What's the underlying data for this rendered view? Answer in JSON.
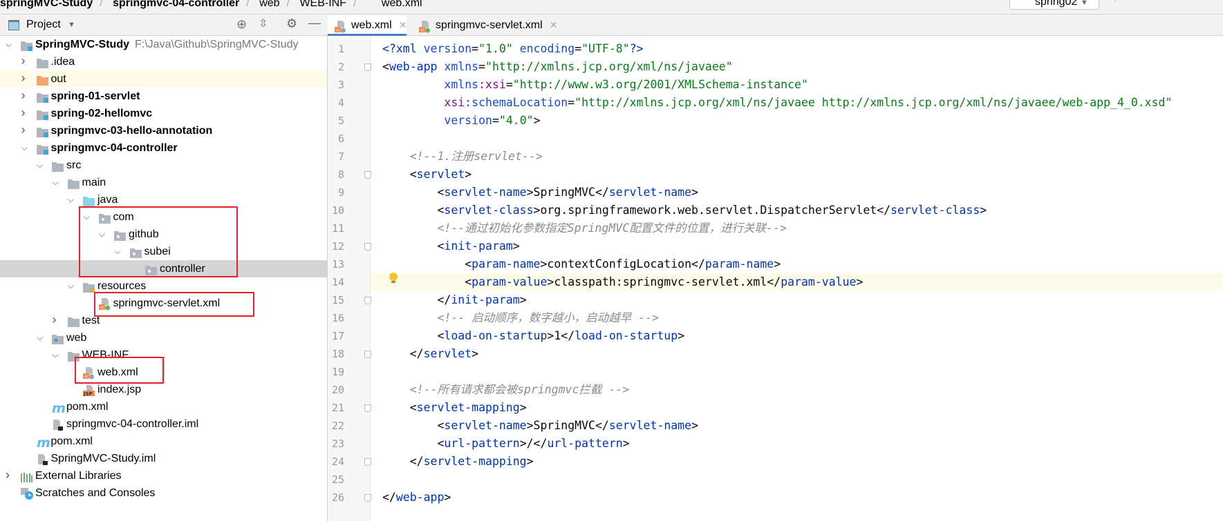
{
  "breadcrumb": [
    "springMVC-Study",
    "springmvc-04-controller",
    "web",
    "WEB-INF",
    "web.xml"
  ],
  "toolbar": {
    "run_config": "spring02"
  },
  "project_panel": {
    "title": "Project",
    "icons": [
      "locate-icon",
      "collapse-all-icon",
      "gear-icon",
      "minimize-icon"
    ]
  },
  "tabs": [
    {
      "label": "web.xml",
      "active": true
    },
    {
      "label": "springmvc-servlet.xml",
      "active": false
    }
  ],
  "tree": [
    {
      "label": "SpringMVC-Study",
      "path": "F:\\Java\\Github\\SpringMVC-Study",
      "level": 0,
      "arrow": "open",
      "icon": "module",
      "bold": true
    },
    {
      "label": ".idea",
      "level": 1,
      "arrow": "closed",
      "icon": "folder"
    },
    {
      "label": "out",
      "level": 1,
      "arrow": "closed",
      "icon": "folder-orange",
      "highlight": true
    },
    {
      "label": "spring-01-servlet",
      "level": 1,
      "arrow": "closed",
      "icon": "module",
      "bold": true
    },
    {
      "label": "spring-02-hellomvc",
      "level": 1,
      "arrow": "closed",
      "icon": "module",
      "bold": true
    },
    {
      "label": "springmvc-03-hello-annotation",
      "level": 1,
      "arrow": "closed",
      "icon": "module",
      "bold": true
    },
    {
      "label": "springmvc-04-controller",
      "level": 1,
      "arrow": "open",
      "icon": "module",
      "bold": true
    },
    {
      "label": "src",
      "level": 2,
      "arrow": "open",
      "icon": "folder"
    },
    {
      "label": "main",
      "level": 3,
      "arrow": "open",
      "icon": "folder"
    },
    {
      "label": "java",
      "level": 4,
      "arrow": "open",
      "icon": "folder-blue"
    },
    {
      "label": "com",
      "level": 5,
      "arrow": "open",
      "icon": "package"
    },
    {
      "label": "github",
      "level": 6,
      "arrow": "open",
      "icon": "package"
    },
    {
      "label": "subei",
      "level": 7,
      "arrow": "open",
      "icon": "package"
    },
    {
      "label": "controller",
      "level": 8,
      "arrow": "none",
      "icon": "package",
      "selected": true
    },
    {
      "label": "resources",
      "level": 4,
      "arrow": "open",
      "icon": "folder-res"
    },
    {
      "label": "springmvc-servlet.xml",
      "level": 5,
      "arrow": "none",
      "icon": "xml-spring"
    },
    {
      "label": "test",
      "level": 3,
      "arrow": "closed",
      "icon": "folder"
    },
    {
      "label": "web",
      "level": 2,
      "arrow": "open",
      "icon": "folder-web"
    },
    {
      "label": "WEB-INF",
      "level": 3,
      "arrow": "open",
      "icon": "folder"
    },
    {
      "label": "web.xml",
      "level": 4,
      "arrow": "none",
      "icon": "xml-web"
    },
    {
      "label": "index.jsp",
      "level": 4,
      "arrow": "none",
      "icon": "jsp"
    },
    {
      "label": "pom.xml",
      "level": 2,
      "arrow": "none",
      "icon": "maven"
    },
    {
      "label": "springmvc-04-controller.iml",
      "level": 2,
      "arrow": "none",
      "icon": "iml"
    },
    {
      "label": "pom.xml",
      "level": 1,
      "arrow": "none",
      "icon": "maven"
    },
    {
      "label": "SpringMVC-Study.iml",
      "level": 1,
      "arrow": "none",
      "icon": "iml"
    },
    {
      "label": "External Libraries",
      "level": 0,
      "arrow": "closed",
      "icon": "libraries"
    },
    {
      "label": "Scratches and Consoles",
      "level": 0,
      "arrow": "none",
      "icon": "scratches"
    }
  ],
  "colors": {
    "tag": "#0033b3",
    "attr": "#174ad4",
    "value": "#067d17",
    "namespace": "#871094",
    "comment": "#8c8c8c",
    "highlight_box": "#e8202a"
  },
  "editor": {
    "current_line": 14,
    "lines": [
      [
        [
          "tag",
          "<?xml "
        ],
        [
          "attr",
          "version"
        ],
        [
          "txt",
          "="
        ],
        [
          "val",
          "\"1.0\" "
        ],
        [
          "attr",
          "encoding"
        ],
        [
          "txt",
          "="
        ],
        [
          "val",
          "\"UTF-8\""
        ],
        [
          "tag",
          "?>"
        ]
      ],
      [
        [
          "txt",
          "<"
        ],
        [
          "tag",
          "web-app "
        ],
        [
          "attr",
          "xmlns"
        ],
        [
          "txt",
          "="
        ],
        [
          "val",
          "\"http://xmlns.jcp.org/xml/ns/javaee\""
        ]
      ],
      [
        [
          "txt",
          "         "
        ],
        [
          "attr",
          "xmlns"
        ],
        [
          "ns",
          ":xsi"
        ],
        [
          "txt",
          "="
        ],
        [
          "val",
          "\"http://www.w3.org/2001/XMLSchema-instance\""
        ]
      ],
      [
        [
          "txt",
          "         "
        ],
        [
          "ns",
          "xsi"
        ],
        [
          "attr",
          ":schemaLocation"
        ],
        [
          "txt",
          "="
        ],
        [
          "val",
          "\"http://xmlns.jcp.org/xml/ns/javaee http://xmlns.jcp.org/xml/ns/javaee/web-app_4_0.xsd\""
        ]
      ],
      [
        [
          "txt",
          "         "
        ],
        [
          "attr",
          "version"
        ],
        [
          "txt",
          "="
        ],
        [
          "val",
          "\"4.0\""
        ],
        [
          "txt",
          ">"
        ]
      ],
      [],
      [
        [
          "txt",
          "    "
        ],
        [
          "com",
          "<!--1.注册servlet-->"
        ]
      ],
      [
        [
          "txt",
          "    <"
        ],
        [
          "tag",
          "servlet"
        ],
        [
          "txt",
          ">"
        ]
      ],
      [
        [
          "txt",
          "        <"
        ],
        [
          "tag",
          "servlet-name"
        ],
        [
          "txt",
          ">SpringMVC</"
        ],
        [
          "tag",
          "servlet-name"
        ],
        [
          "txt",
          ">"
        ]
      ],
      [
        [
          "txt",
          "        <"
        ],
        [
          "tag",
          "servlet-class"
        ],
        [
          "txt",
          ">org.springframework.web.servlet.DispatcherServlet</"
        ],
        [
          "tag",
          "servlet-class"
        ],
        [
          "txt",
          ">"
        ]
      ],
      [
        [
          "txt",
          "        "
        ],
        [
          "com",
          "<!--通过初始化参数指定SpringMVC配置文件的位置，进行关联-->"
        ]
      ],
      [
        [
          "txt",
          "        <"
        ],
        [
          "tag",
          "init-param"
        ],
        [
          "txt",
          ">"
        ]
      ],
      [
        [
          "txt",
          "            <"
        ],
        [
          "tag",
          "param-name"
        ],
        [
          "txt",
          ">contextConfigLocation</"
        ],
        [
          "tag",
          "param-name"
        ],
        [
          "txt",
          ">"
        ]
      ],
      [
        [
          "txt",
          "            <"
        ],
        [
          "tag",
          "param-value"
        ],
        [
          "txt",
          ">classpath:springmvc-servlet.xml</"
        ],
        [
          "tag",
          "param-value"
        ],
        [
          "txt",
          ">"
        ]
      ],
      [
        [
          "txt",
          "        </"
        ],
        [
          "tag",
          "init-param"
        ],
        [
          "txt",
          ">"
        ]
      ],
      [
        [
          "txt",
          "        "
        ],
        [
          "com",
          "<!-- 启动顺序，数字越小，启动越早 -->"
        ]
      ],
      [
        [
          "txt",
          "        <"
        ],
        [
          "tag",
          "load-on-startup"
        ],
        [
          "txt",
          ">1</"
        ],
        [
          "tag",
          "load-on-startup"
        ],
        [
          "txt",
          ">"
        ]
      ],
      [
        [
          "txt",
          "    </"
        ],
        [
          "tag",
          "servlet"
        ],
        [
          "txt",
          ">"
        ]
      ],
      [],
      [
        [
          "txt",
          "    "
        ],
        [
          "com",
          "<!--所有请求都会被springmvc拦截 -->"
        ]
      ],
      [
        [
          "txt",
          "    <"
        ],
        [
          "tag",
          "servlet-mapping"
        ],
        [
          "txt",
          ">"
        ]
      ],
      [
        [
          "txt",
          "        <"
        ],
        [
          "tag",
          "servlet-name"
        ],
        [
          "txt",
          ">SpringMVC</"
        ],
        [
          "tag",
          "servlet-name"
        ],
        [
          "txt",
          ">"
        ]
      ],
      [
        [
          "txt",
          "        <"
        ],
        [
          "tag",
          "url-pattern"
        ],
        [
          "txt",
          ">/</"
        ],
        [
          "tag",
          "url-pattern"
        ],
        [
          "txt",
          ">"
        ]
      ],
      [
        [
          "txt",
          "    </"
        ],
        [
          "tag",
          "servlet-mapping"
        ],
        [
          "txt",
          ">"
        ]
      ],
      [],
      [
        [
          "txt",
          "</"
        ],
        [
          "tag",
          "web-app"
        ],
        [
          "txt",
          ">"
        ]
      ]
    ]
  }
}
